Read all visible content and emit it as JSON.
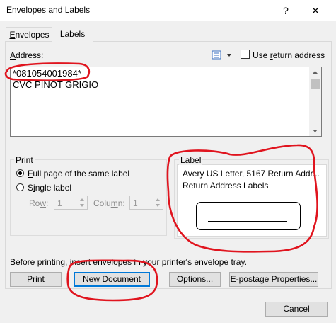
{
  "window": {
    "title": "Envelopes and Labels",
    "help": "?",
    "close": "✕"
  },
  "tabs": [
    {
      "label": "Envelopes",
      "accel": "E",
      "rest": "nvelopes"
    },
    {
      "label": "Labels",
      "accel": "L",
      "rest": "abels"
    }
  ],
  "address": {
    "label_pre": "",
    "label_accel": "A",
    "label_rest": "ddress:",
    "lines": [
      "*081054001984*",
      "CVC PINOT GRIGIO"
    ],
    "use_return_prefix": "Use ",
    "use_return_accel": "r",
    "use_return_suffix": "eturn address",
    "use_return_checked": false
  },
  "print_group": {
    "title": "Print",
    "full_page": {
      "pre": "",
      "accel": "F",
      "rest": "ull page of the same label",
      "selected": true
    },
    "single": {
      "pre": "S",
      "accel": "i",
      "rest": "ngle label",
      "selected": false
    },
    "row_label_pre": "Ro",
    "row_accel": "w",
    "row_label_rest": ":",
    "row_value": "1",
    "column_label_pre": "Colu",
    "column_accel": "m",
    "column_label_rest": "n:",
    "column_value": "1"
  },
  "label_group": {
    "title": "Label",
    "product": "Avery US Letter, 5167 Return Addr...",
    "description": "Return Address Labels"
  },
  "info_text": "Before printing, insert envelopes in your printer's envelope tray.",
  "buttons": {
    "print": {
      "pre": "",
      "accel": "P",
      "rest": "rint"
    },
    "new_document": {
      "pre": "New ",
      "accel": "D",
      "rest": "ocument"
    },
    "options": {
      "pre": "",
      "accel": "O",
      "rest": "ptions..."
    },
    "epostage": {
      "pre": "E-p",
      "accel": "o",
      "rest": "stage Properties..."
    },
    "cancel": "Cancel"
  }
}
